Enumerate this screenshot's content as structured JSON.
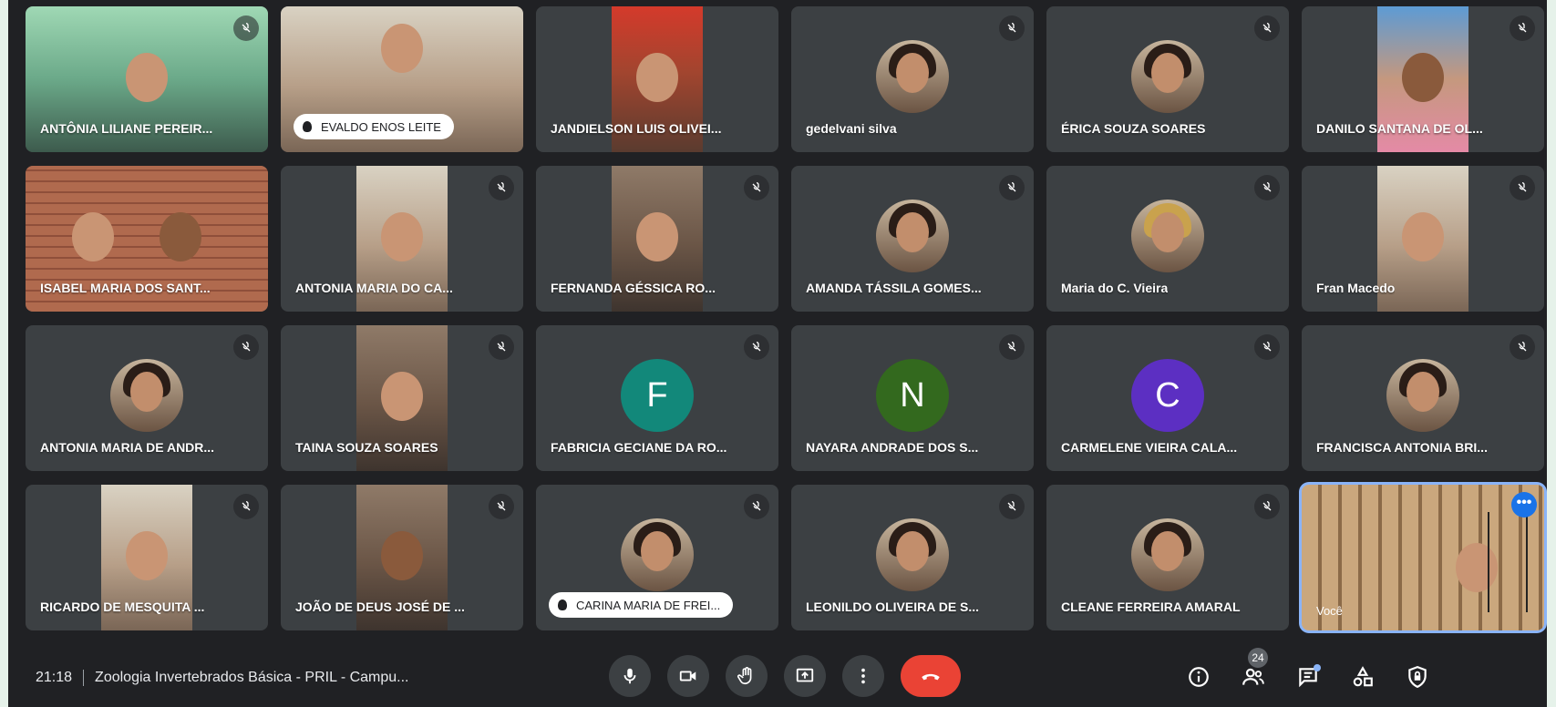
{
  "meeting": {
    "time": "21:18",
    "title": "Zoologia Invertebrados Básica - PRIL - Campu..."
  },
  "participants_count": "24",
  "colors": {
    "background": "#202124",
    "tile": "#3c4043",
    "end_call": "#ea4335",
    "active_border": "#8ab4f8",
    "initial_F": "#12887a",
    "initial_N": "#33691e",
    "initial_C": "#5c2fc2"
  },
  "tiles": [
    {
      "name": "ANTÔNIA LILIANE PEREIR..."
    },
    {
      "name": "EVALDO ENOS LEITE"
    },
    {
      "name": "JANDIELSON LUIS OLIVEI..."
    },
    {
      "name": "gedelvani silva"
    },
    {
      "name": "ÉRICA SOUZA SOARES"
    },
    {
      "name": "DANILO SANTANA DE OL..."
    },
    {
      "name": "ISABEL MARIA DOS SANT..."
    },
    {
      "name": "ANTONIA MARIA DO CA..."
    },
    {
      "name": "FERNANDA GÉSSICA RO..."
    },
    {
      "name": "AMANDA TÁSSILA GOMES..."
    },
    {
      "name": "Maria do C. Vieira"
    },
    {
      "name": "Fran Macedo"
    },
    {
      "name": "ANTONIA MARIA DE ANDR..."
    },
    {
      "name": "TAINA SOUZA SOARES"
    },
    {
      "name": "FABRICIA GECIANE DA RO...",
      "initial": "F"
    },
    {
      "name": "NAYARA ANDRADE DOS S...",
      "initial": "N"
    },
    {
      "name": "CARMELENE VIEIRA CALA...",
      "initial": "C"
    },
    {
      "name": "FRANCISCA ANTONIA BRI..."
    },
    {
      "name": "RICARDO DE MESQUITA ..."
    },
    {
      "name": "JOÃO DE DEUS JOSÉ DE ..."
    },
    {
      "name": "CARINA MARIA DE FREI..."
    },
    {
      "name": "LEONILDO OLIVEIRA DE S..."
    },
    {
      "name": "CLEANE FERREIRA AMARAL"
    },
    {
      "name": "Você"
    }
  ],
  "icons": {
    "mute": "mic-off-icon",
    "pin": "pin-icon",
    "more": "more-options-icon",
    "mic": "mic-icon",
    "camera": "camera-icon",
    "hand": "raise-hand-icon",
    "present": "present-screen-icon",
    "menu": "more-vert-icon",
    "end": "end-call-icon",
    "info": "info-icon",
    "people": "people-icon",
    "chat": "chat-icon",
    "activities": "activities-icon",
    "host": "host-controls-icon"
  }
}
